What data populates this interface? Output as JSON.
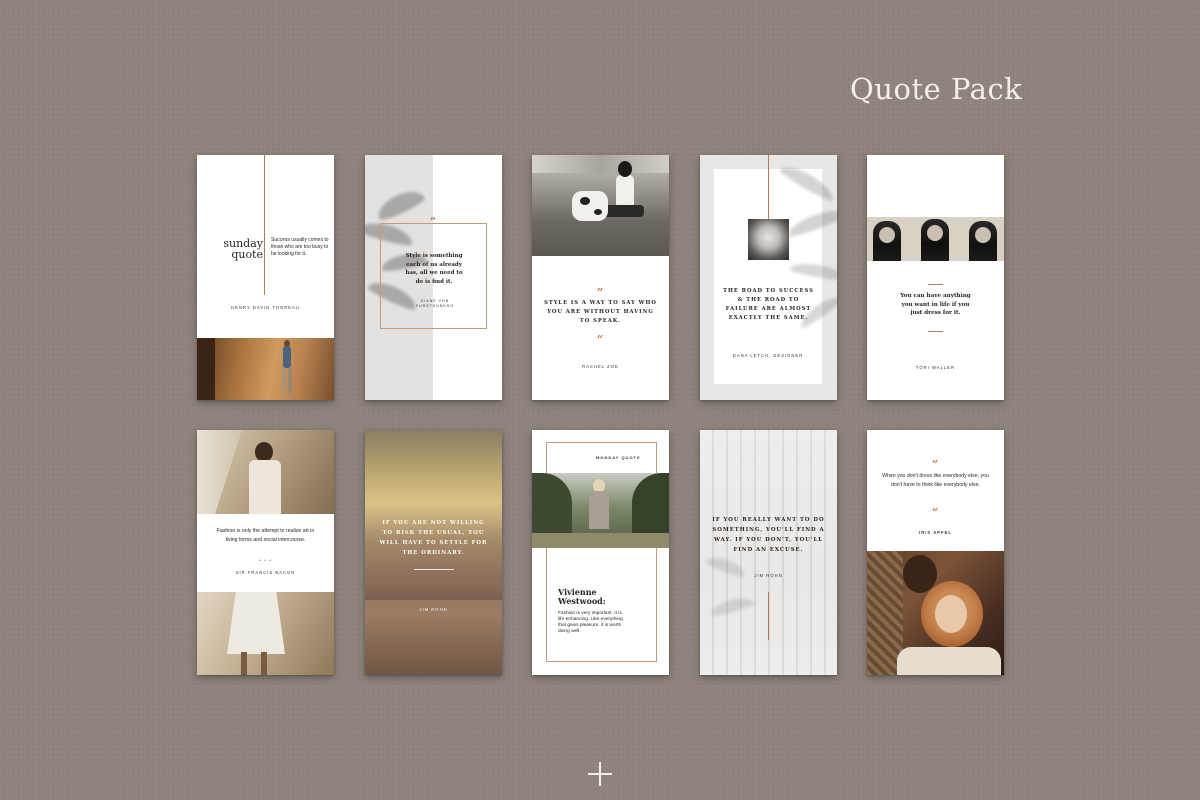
{
  "header": {
    "title": "Quote Pack"
  },
  "cards": {
    "c1": {
      "heading_line1": "sunday",
      "heading_line2": "quote",
      "body": "Success usually comes to those who are too busy to be looking for it.",
      "author": "HENRY DAVID THOREAU"
    },
    "c2": {
      "quote_mark": "”",
      "body": "Style is something each of us already has, all we need to do is find it.",
      "author_line1": "DIANE VON",
      "author_line2": "FURSTENBERG"
    },
    "c3": {
      "quote_mark_top": "”",
      "body": "STYLE IS A WAY TO SAY WHO YOU ARE WITHOUT HAVING TO SPEAK.",
      "quote_mark_bottom": "“",
      "author": "RACHEL ZOE"
    },
    "c4": {
      "body": "THE ROAD TO SUCCESS & THE ROAD TO FAILURE ARE ALMOST EXACTLY THE SAME.",
      "author": "DANA LETCH, DESIGNER"
    },
    "c5": {
      "body": "You can have anything you want in life if you just dress for it.",
      "author": "TORI WALLER"
    },
    "c6": {
      "body": "Fashion is only the attempt to realize art in living forms and social intercourse.",
      "author": "SIR FRANCIS BACON"
    },
    "c7": {
      "body": "IF YOU ARE NOT WILLING TO RISK THE USUAL, YOU WILL HAVE TO SETTLE FOR THE ORDINARY.",
      "author": "JIM ROHN"
    },
    "c8": {
      "label": "MONDAY QUOTE",
      "heading_line1": "Vivienne",
      "heading_line2": "Westwood:",
      "body": "Fashion is very important. It is life-enhancing. Like everything that gives pleasure, it is worth doing well."
    },
    "c9": {
      "body": "IF YOU REALLY WANT TO DO SOMETHING, YOU'LL FIND A WAY. IF YOU DON'T, YOU'LL FIND AN EXCUSE.",
      "author": "JIM ROHN"
    },
    "c10": {
      "quote_mark_top": "”",
      "body": "When you don't dress like everybody else, you don't have to think like everybody else.",
      "quote_mark_bottom": "“",
      "author": "IRIS APFEL"
    }
  },
  "icons": {
    "plus": "plus-icon",
    "quote": "quote-mark-icon"
  },
  "colors": {
    "background": "#8e837c",
    "accent": "#b07c58",
    "text": "#2a2522"
  }
}
